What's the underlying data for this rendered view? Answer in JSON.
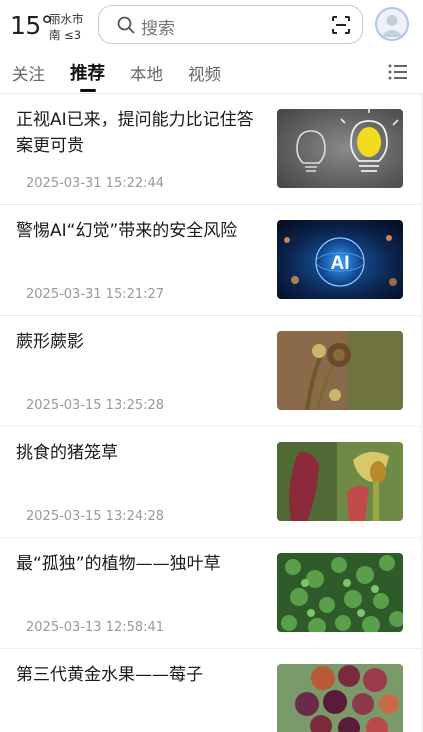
{
  "header": {
    "temperature": "15°",
    "city": "丽水市",
    "wind": "南 ≤3",
    "search_placeholder": "搜索"
  },
  "tabs": [
    {
      "label": "关注",
      "active": false
    },
    {
      "label": "推荐",
      "active": true
    },
    {
      "label": "本地",
      "active": false
    },
    {
      "label": "视频",
      "active": false
    }
  ],
  "news": [
    {
      "title": "正视AI已来，提问能力比记住答案更可贵",
      "time": "2025-03-31 15:22:44",
      "thumb": "lightbulb-image"
    },
    {
      "title": "警惕AI“幻觉”带来的安全风险",
      "time": "2025-03-31 15:21:27",
      "thumb": "ai-sphere-image",
      "thumb_text": "AI"
    },
    {
      "title": "蕨形蕨影",
      "time": "2025-03-15 13:25:28",
      "thumb": "fern-image"
    },
    {
      "title": "挑食的猪笼草",
      "time": "2025-03-15 13:24:28",
      "thumb": "pitcher-plant-image"
    },
    {
      "title": "最“孤独”的植物——独叶草",
      "time": "2025-03-13 12:58:41",
      "thumb": "clover-plant-image"
    },
    {
      "title": "第三代黄金水果——莓子",
      "time": "",
      "thumb": "berries-image"
    }
  ]
}
